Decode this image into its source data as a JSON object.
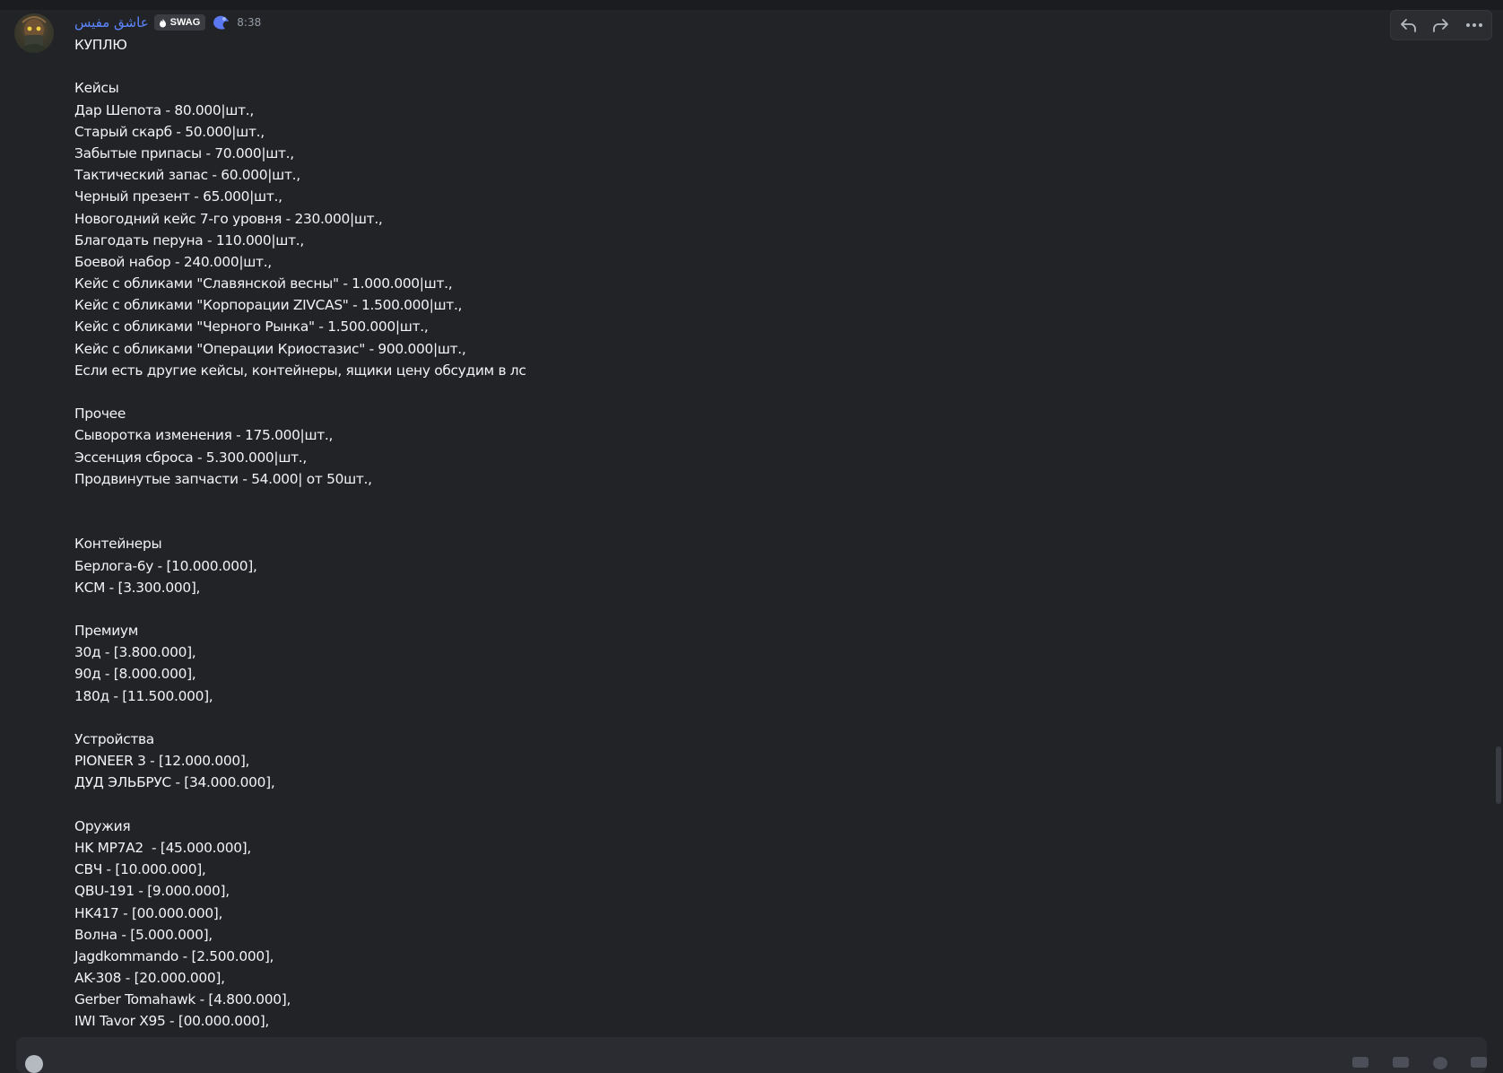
{
  "message": {
    "author": "عاشق مفیس",
    "tag": "SWAG",
    "time": "8:38",
    "lines": [
      "КУПЛЮ",
      "",
      "Кейсы",
      "Дар Шепота - 80.000|шт.,",
      "Старый скарб - 50.000|шт.,",
      "Забытые припасы - 70.000|шт.,",
      "Тактический запас - 60.000|шт.,",
      "Черный презент - 65.000|шт.,",
      "Новогодний кейс 7-го уровня - 230.000|шт.,",
      "Благодать перуна - 110.000|шт.,",
      "Боевой набор - 240.000|шт.,",
      "Кейс с обликами \"Славянской весны\" - 1.000.000|шт.,",
      "Кейс с обликами \"Корпорации ZIVCAS\" - 1.500.000|шт.,",
      "Кейс с обликами \"Черного Рынка\" - 1.500.000|шт.,",
      "Кейс с обликами \"Операции Криостазис\" - 900.000|шт.,",
      "Если есть другие кейсы, контейнеры, ящики цену обсудим в лс",
      "",
      "Прочее",
      "Сыворотка изменения - 175.000|шт.,",
      "Эссенция сброса - 5.300.000|шт.,",
      "Продвинутые запчасти - 54.000| от 50шт.,",
      "",
      "",
      "Контейнеры",
      "Берлога-6у - [10.000.000],",
      "КСМ - [3.300.000],",
      "",
      "Премиум",
      "30д - [3.800.000],",
      "90д - [8.000.000],",
      "180д - [11.500.000],",
      "",
      "Устройства",
      "PIONEER 3 - [12.000.000],",
      "ДУД ЭЛЬБРУС - [34.000.000],",
      "",
      "Оружия",
      "HK MP7A2  - [45.000.000],",
      "СВЧ - [10.000.000],",
      "QBU-191 - [9.000.000],",
      "HK417 - [00.000.000],",
      "Волна - [5.000.000],",
      "Jagdkommando - [2.500.000],",
      "AK-308 - [20.000.000],",
      "Gerber Tomahawk - [4.800.000],",
      "IWI Tavor X95 - [00.000.000],"
    ]
  },
  "icons": {
    "toolbar": [
      "reply-icon",
      "forward-icon",
      "more-icon"
    ],
    "composer": [
      "add-icon",
      "gift-icon",
      "gif-icon",
      "sticker-icon",
      "emoji-icon"
    ]
  },
  "colors": {
    "background": "#222327",
    "username": "#5d86ff",
    "text": "#f2f3f5",
    "timestamp": "#949ba4"
  }
}
